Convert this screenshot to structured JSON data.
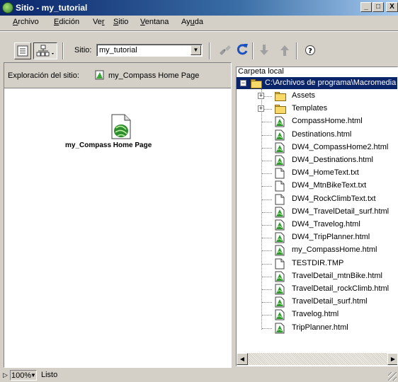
{
  "window": {
    "title": "Sitio - my_tutorial",
    "controls": {
      "minimize": "_",
      "maximize": "□",
      "close": "X"
    }
  },
  "menu": {
    "items": [
      {
        "label": "Archivo",
        "underline": "A",
        "rest": "rchivo"
      },
      {
        "label": "Edición",
        "underline": "E",
        "rest": "dición"
      },
      {
        "label": "Ver",
        "pre": "Ve",
        "underline": "r",
        "rest": ""
      },
      {
        "label": "Sitio",
        "underline": "S",
        "rest": "itio"
      },
      {
        "label": "Ventana",
        "underline": "V",
        "rest": "entana"
      },
      {
        "label": "Ayuda",
        "pre": "Ay",
        "underline": "u",
        "rest": "da"
      }
    ]
  },
  "toolbar": {
    "site_label": "Sitio:",
    "site_value": "my_tutorial",
    "icons": [
      "site-files-icon",
      "site-map-icon",
      "connect-icon",
      "refresh-icon",
      "get-icon",
      "put-icon",
      "help-icon"
    ]
  },
  "left_panel": {
    "header_label": "Exploración del sitio:",
    "home_name": "my_Compass Home Page",
    "page_caption": "my_Compass Home Page"
  },
  "right_panel": {
    "header": "Carpeta local",
    "root_path": "C:\\Archivos de programa\\Macromedia",
    "items": [
      {
        "name": "Assets",
        "type": "folder"
      },
      {
        "name": "Templates",
        "type": "folder"
      },
      {
        "name": "CompassHome.html",
        "type": "html"
      },
      {
        "name": "Destinations.html",
        "type": "html"
      },
      {
        "name": "DW4_CompassHome2.html",
        "type": "html"
      },
      {
        "name": "DW4_Destinations.html",
        "type": "html"
      },
      {
        "name": "DW4_HomeText.txt",
        "type": "txt"
      },
      {
        "name": "DW4_MtnBikeText.txt",
        "type": "txt"
      },
      {
        "name": "DW4_RockClimbText.txt",
        "type": "txt"
      },
      {
        "name": "DW4_TravelDetail_surf.html",
        "type": "html"
      },
      {
        "name": "DW4_Travelog.html",
        "type": "html"
      },
      {
        "name": "DW4_TripPlanner.html",
        "type": "html"
      },
      {
        "name": "my_CompassHome.html",
        "type": "html"
      },
      {
        "name": "TESTDIR.TMP",
        "type": "txt"
      },
      {
        "name": "TravelDetail_mtnBike.html",
        "type": "html"
      },
      {
        "name": "TravelDetail_rockClimb.html",
        "type": "html"
      },
      {
        "name": "TravelDetail_surf.html",
        "type": "html"
      },
      {
        "name": "Travelog.html",
        "type": "html"
      },
      {
        "name": "TripPlanner.html",
        "type": "html"
      }
    ]
  },
  "status": {
    "zoom": "100%",
    "text": "Listo"
  },
  "colors": {
    "title_start": "#0a246a",
    "title_end": "#a6caf0",
    "face": "#d4d0c8",
    "selection": "#0a246a"
  }
}
